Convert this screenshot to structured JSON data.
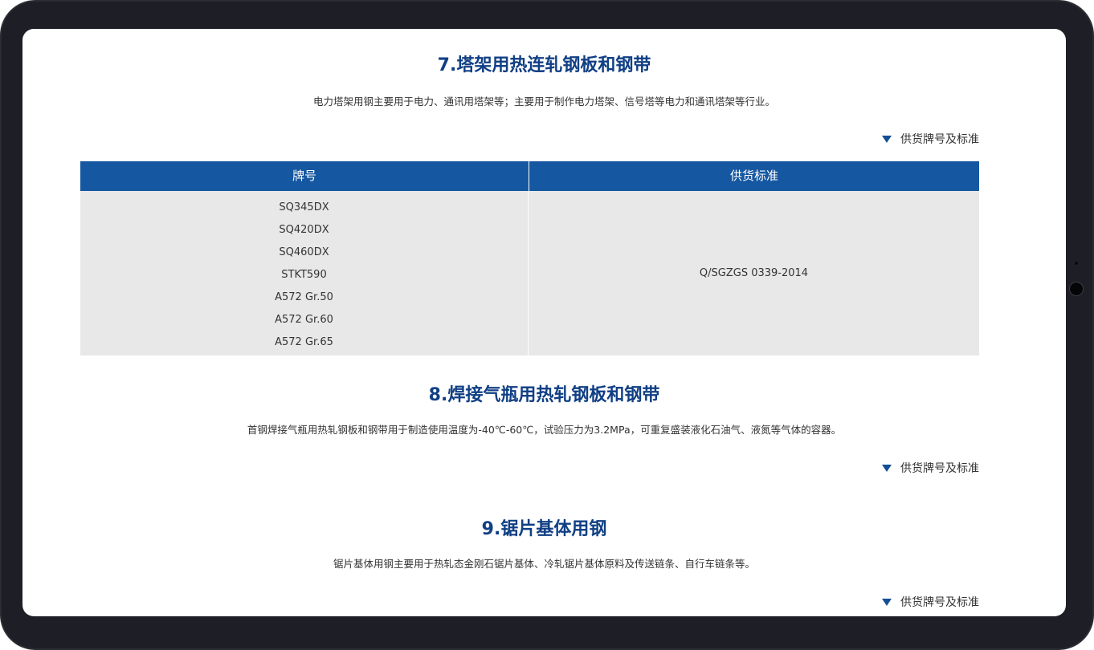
{
  "sections": [
    {
      "title": "7.塔架用热连轧钢板和钢带",
      "description": "电力塔架用钢主要用于电力、通讯用塔架等；主要用于制作电力塔架、信号塔等电力和通讯塔架等行业。",
      "toggle_label": "供货牌号及标准",
      "table": {
        "headers": [
          "牌号",
          "供货标准"
        ],
        "grades": [
          "SQ345DX",
          "SQ420DX",
          "SQ460DX",
          "STKT590",
          "A572 Gr.50",
          "A572 Gr.60",
          "A572 Gr.65"
        ],
        "standard": "Q/SGZGS 0339-2014"
      }
    },
    {
      "title": "8.焊接气瓶用热轧钢板和钢带",
      "description": "首钢焊接气瓶用热轧钢板和钢带用于制造使用温度为-40℃-60℃，试验压力为3.2MPa，可重复盛装液化石油气、液氮等气体的容器。",
      "toggle_label": "供货牌号及标准"
    },
    {
      "title": "9.锯片基体用钢",
      "description": "锯片基体用钢主要用于热轧态金刚石锯片基体、冷轧锯片基体原料及传送链条、自行车链条等。",
      "toggle_label": "供货牌号及标准"
    }
  ],
  "colors": {
    "title": "#103f84",
    "table_header": "#1557a0",
    "table_body": "#e8e8e8",
    "toggle_triangle": "#134f94",
    "bezel": "#1e1e26"
  },
  "icons": {
    "toggle": "caret-down-icon"
  }
}
